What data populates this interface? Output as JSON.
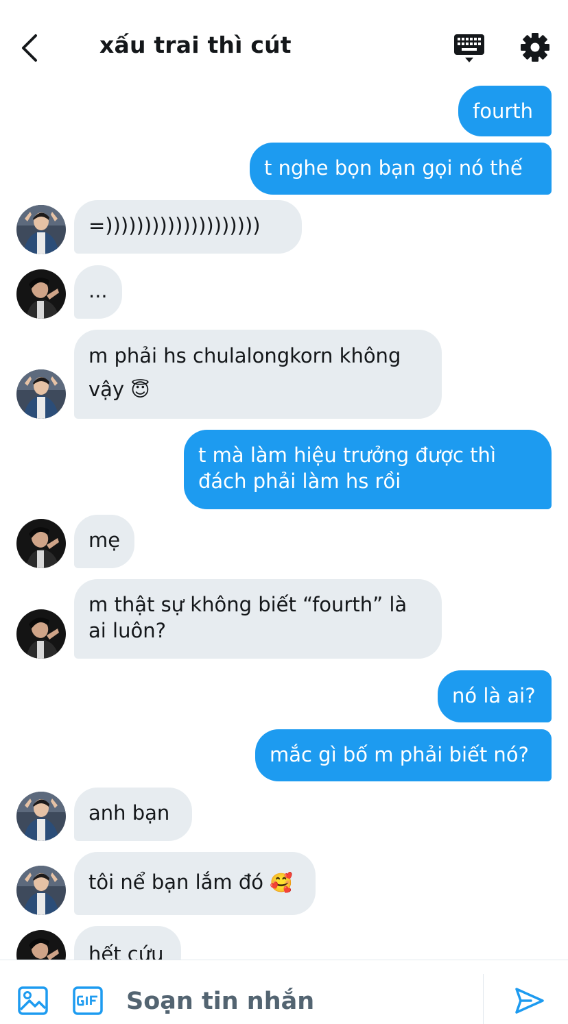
{
  "header": {
    "title": "xấu trai thì cút"
  },
  "messages": [
    {
      "side": "out",
      "text": "fourth"
    },
    {
      "side": "out",
      "text": "t nghe bọn bạn gọi nó thế"
    },
    {
      "side": "in",
      "text": "=))))))))))))))))))))",
      "avatar": "avatar-a"
    },
    {
      "side": "in",
      "text": "...",
      "avatar": "avatar-b"
    },
    {
      "side": "in",
      "text": "m phải hs chulalongkorn không",
      "text2": "vậy",
      "emoji": "😇",
      "avatar": "avatar-a"
    },
    {
      "side": "out",
      "text": "t mà làm hiệu trưởng được thì",
      "text2": "đách phải làm hs rồi"
    },
    {
      "side": "in",
      "text": "mẹ",
      "avatar": "avatar-b"
    },
    {
      "side": "in",
      "text": "m thật sự không biết “fourth” là",
      "text2": "ai luôn?",
      "avatar": "avatar-b"
    },
    {
      "side": "out",
      "text": "nó là ai?"
    },
    {
      "side": "out",
      "text": "mắc gì bố m phải biết nó?"
    },
    {
      "side": "in",
      "text": "anh bạn",
      "avatar": "avatar-a"
    },
    {
      "side": "in",
      "text": "tôi nể bạn lắm đó",
      "emoji": "🥰",
      "avatar": "avatar-a"
    },
    {
      "side": "in",
      "text": "hết cứu",
      "avatar": "avatar-b"
    }
  ],
  "compose": {
    "placeholder": "Soạn tin nhắn"
  },
  "colors": {
    "outgoing_bubble": "#1d9bf0",
    "incoming_bubble": "#e7ecf0",
    "accent": "#1d9bf0",
    "text": "#14171a"
  },
  "icons": {
    "back": "chevron-left-icon",
    "keyboard": "keyboard-icon",
    "settings": "gear-icon",
    "image": "image-icon",
    "gif": "gif-icon",
    "send": "send-icon"
  }
}
